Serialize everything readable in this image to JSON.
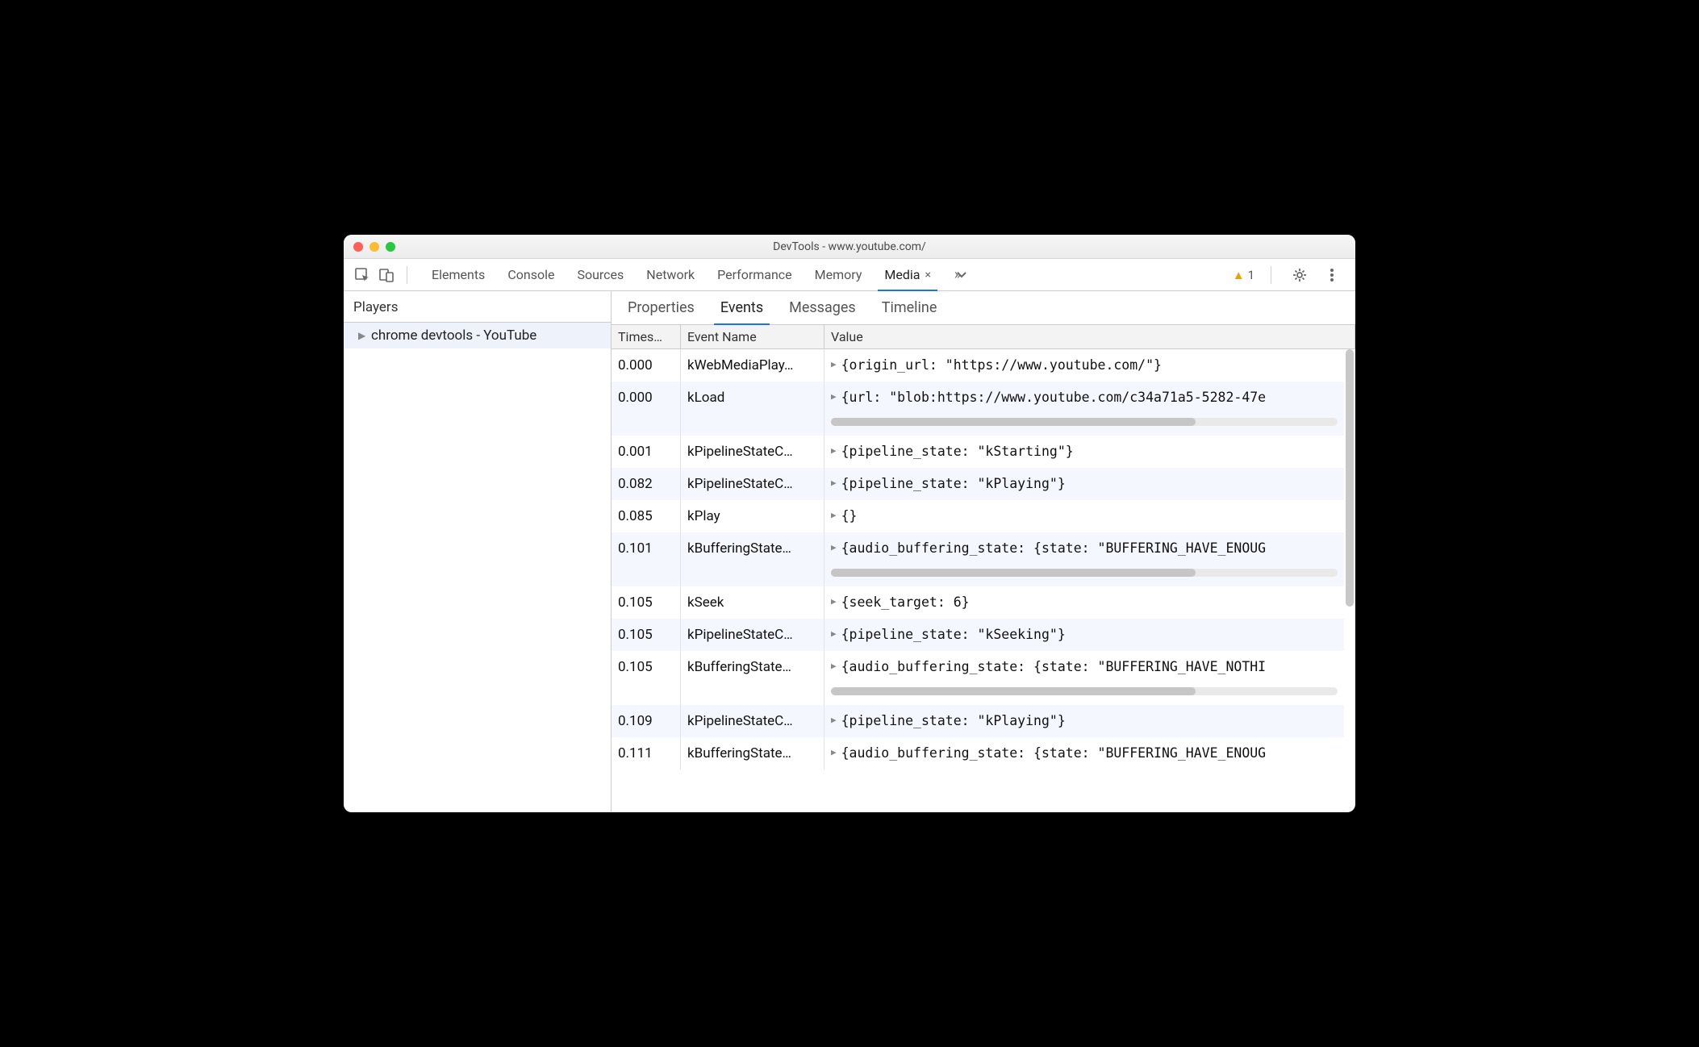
{
  "window_title": "DevTools - www.youtube.com/",
  "toolbar_tabs": [
    "Elements",
    "Console",
    "Sources",
    "Network",
    "Performance",
    "Memory",
    "Media"
  ],
  "toolbar_active_tab": "Media",
  "toolbar_warning_count": "1",
  "sidebar": {
    "header": "Players",
    "players": [
      "chrome devtools - YouTube"
    ]
  },
  "subtabs": [
    "Properties",
    "Events",
    "Messages",
    "Timeline"
  ],
  "subtab_active": "Events",
  "columns": {
    "timestamp": "Times…",
    "event": "Event Name",
    "value": "Value"
  },
  "rows": [
    {
      "ts": "0.000",
      "ev": "kWebMediaPlay…",
      "val": "{origin_url: \"https://www.youtube.com/\"}",
      "hscroll": false,
      "alt": false
    },
    {
      "ts": "0.000",
      "ev": "kLoad",
      "val": "{url: \"blob:https://www.youtube.com/c34a71a5-5282-47e",
      "hscroll": true,
      "alt": true
    },
    {
      "ts": "0.001",
      "ev": "kPipelineStateC…",
      "val": "{pipeline_state: \"kStarting\"}",
      "hscroll": false,
      "alt": false
    },
    {
      "ts": "0.082",
      "ev": "kPipelineStateC…",
      "val": "{pipeline_state: \"kPlaying\"}",
      "hscroll": false,
      "alt": true
    },
    {
      "ts": "0.085",
      "ev": "kPlay",
      "val": "{}",
      "hscroll": false,
      "alt": false
    },
    {
      "ts": "0.101",
      "ev": "kBufferingState…",
      "val": "{audio_buffering_state: {state: \"BUFFERING_HAVE_ENOUG",
      "hscroll": true,
      "alt": true
    },
    {
      "ts": "0.105",
      "ev": "kSeek",
      "val": "{seek_target: 6}",
      "hscroll": false,
      "alt": false
    },
    {
      "ts": "0.105",
      "ev": "kPipelineStateC…",
      "val": "{pipeline_state: \"kSeeking\"}",
      "hscroll": false,
      "alt": true
    },
    {
      "ts": "0.105",
      "ev": "kBufferingState…",
      "val": "{audio_buffering_state: {state: \"BUFFERING_HAVE_NOTHI",
      "hscroll": true,
      "alt": false
    },
    {
      "ts": "0.109",
      "ev": "kPipelineStateC…",
      "val": "{pipeline_state: \"kPlaying\"}",
      "hscroll": false,
      "alt": true
    },
    {
      "ts": "0.111",
      "ev": "kBufferingState…",
      "val": "{audio_buffering_state: {state: \"BUFFERING_HAVE_ENOUG",
      "hscroll": false,
      "alt": false
    }
  ]
}
